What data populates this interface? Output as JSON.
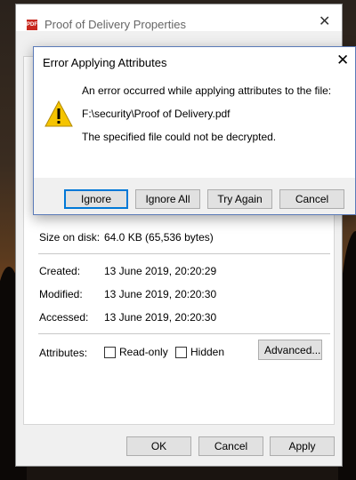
{
  "properties_window": {
    "title": "Proof of Delivery Properties",
    "icon": "pdf-file-icon",
    "rows": [
      {
        "label": "Size on disk:",
        "value": "64.0 KB (65,536 bytes)"
      },
      {
        "label": "Created:",
        "value": "13 June 2019, 20:20:29"
      },
      {
        "label": "Modified:",
        "value": "13 June 2019, 20:20:30"
      },
      {
        "label": "Accessed:",
        "value": "13 June 2019, 20:20:30"
      }
    ],
    "attributes": {
      "label": "Attributes:",
      "readonly_label": "Read-only",
      "readonly_checked": false,
      "hidden_label": "Hidden",
      "hidden_checked": false,
      "advanced_label": "Advanced..."
    },
    "buttons": {
      "ok": "OK",
      "cancel": "Cancel",
      "apply": "Apply"
    }
  },
  "error_dialog": {
    "title": "Error Applying Attributes",
    "icon": "warning-icon",
    "message": "An error occurred while applying attributes to the file:",
    "path": "F:\\security\\Proof of Delivery.pdf",
    "detail": "The specified file could not be decrypted.",
    "buttons": {
      "ignore": "Ignore",
      "ignore_all": "Ignore All",
      "try_again": "Try Again",
      "cancel": "Cancel"
    }
  },
  "colors": {
    "accent": "#0078d7",
    "warning": "#f5c400",
    "pdf": "#c8281e"
  }
}
